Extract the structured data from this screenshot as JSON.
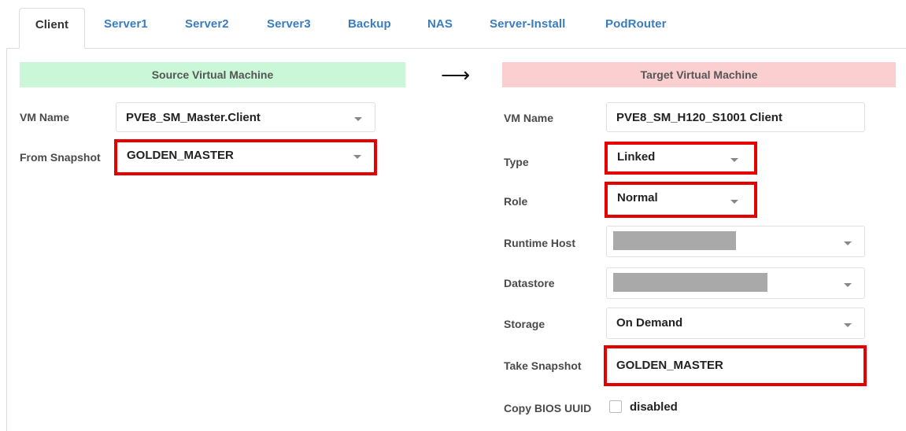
{
  "tabs": [
    {
      "label": "Client",
      "active": true
    },
    {
      "label": "Server1",
      "active": false
    },
    {
      "label": "Server2",
      "active": false
    },
    {
      "label": "Server3",
      "active": false
    },
    {
      "label": "Backup",
      "active": false
    },
    {
      "label": "NAS",
      "active": false
    },
    {
      "label": "Server-Install",
      "active": false
    },
    {
      "label": "PodRouter",
      "active": false
    }
  ],
  "source": {
    "header": "Source Virtual Machine",
    "vm_name_label": "VM Name",
    "vm_name_value": "PVE8_SM_Master.Client",
    "snapshot_label": "From Snapshot",
    "snapshot_value": "GOLDEN_MASTER"
  },
  "arrow": "⟶",
  "target": {
    "header": "Target Virtual Machine",
    "vm_name_label": "VM Name",
    "vm_name_value": "PVE8_SM_H120_S1001 Client",
    "type_label": "Type",
    "type_value": "Linked",
    "role_label": "Role",
    "role_value": "Normal",
    "runtime_host_label": "Runtime Host",
    "datastore_label": "Datastore",
    "storage_label": "Storage",
    "storage_value": "On Demand",
    "take_snapshot_label": "Take Snapshot",
    "take_snapshot_value": "GOLDEN_MASTER",
    "copy_bios_label": "Copy BIOS UUID",
    "copy_bios_value": "disabled",
    "copy_bios_checked": false
  },
  "colors": {
    "tab_link": "#3a7cc2",
    "source_header_bg": "#c9f7d8",
    "target_header_bg": "#fbcfcf",
    "highlight": "#e60000",
    "redacted": "#a9a9a9"
  }
}
